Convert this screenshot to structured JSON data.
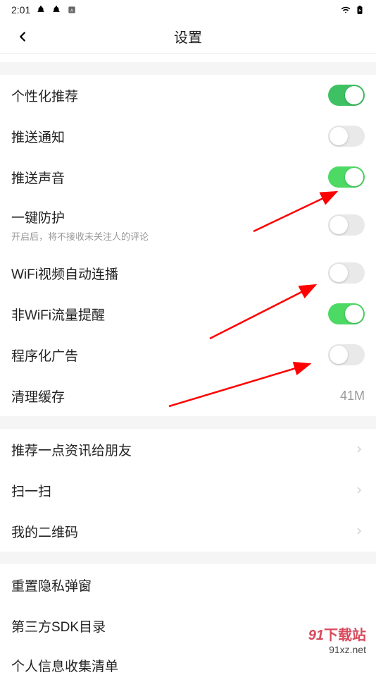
{
  "statusBar": {
    "time": "2:01"
  },
  "header": {
    "title": "设置"
  },
  "partialRowText": "",
  "section1": {
    "items": [
      {
        "label": "个性化推荐",
        "toggle": true
      },
      {
        "label": "推送通知",
        "toggle": false
      },
      {
        "label": "推送声音",
        "toggle": true
      },
      {
        "label": "一键防护",
        "sublabel": "开启后，将不接收未关注人的评论",
        "toggle": false
      },
      {
        "label": "WiFi视频自动连播",
        "toggle": false
      },
      {
        "label": "非WiFi流量提醒",
        "toggle": true
      },
      {
        "label": "程序化广告",
        "toggle": false
      },
      {
        "label": "清理缓存",
        "value": "41M"
      }
    ]
  },
  "section2": {
    "items": [
      {
        "label": "推荐一点资讯给朋友"
      },
      {
        "label": "扫一扫"
      },
      {
        "label": "我的二维码"
      }
    ]
  },
  "section3": {
    "items": [
      {
        "label": "重置隐私弹窗"
      },
      {
        "label": "第三方SDK目录"
      },
      {
        "label": "个人信息收集清单"
      }
    ]
  },
  "watermark": {
    "line1": "下载站",
    "line2": "91xz.net"
  }
}
